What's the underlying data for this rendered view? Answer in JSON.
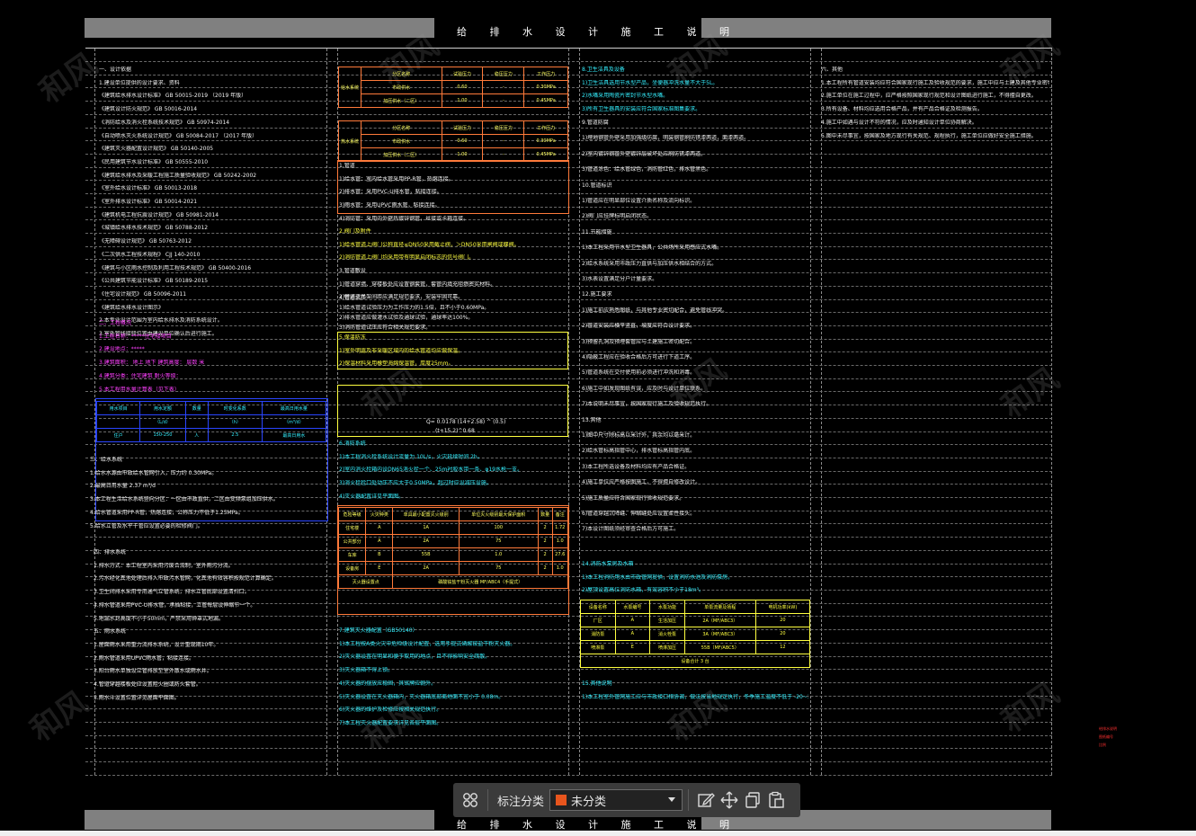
{
  "title": "给 排 水 设 计 施 工 说 明",
  "toolbar": {
    "category_label": "标注分类",
    "category_value": "未分类",
    "swatch_color": "#e8551d",
    "icons": [
      "grid-icon",
      "edit-icon",
      "move-icon",
      "copy-icon",
      "paste-icon"
    ]
  },
  "watermark": "和风",
  "col1": {
    "white_lines_a": [
      "一、设计依据",
      "1.建设单位提供的设计要求、资料",
      "《建筑给水排水设计标准》  GB 50015-2019  （2019 年版）",
      "《建筑设计防火规范》  GB 50016-2014",
      "《消防给水及消火栓系统技术规范》  GB 50974-2014",
      "《自动喷水灭火系统设计规范》  GB 50084-2017  （2017 年版）",
      "《建筑灭火器配置设计规范》  GB 50140-2005",
      "《民用建筑节水设计标准》  GB 50555-2010",
      "《建筑给水排水及采暖工程施工质量验收规范》  GB 50242-2002",
      "《室外给水设计标准》  GB 50013-2018",
      "《室外排水设计标准》  GB 50014-2021",
      "《建筑机电工程抗震设计规范》  GB 50981-2014",
      "《城镇给水排水技术规范》  GB 50788-2012",
      "《无障碍设计规范》  GB 50763-2012",
      "《二次供水工程技术规程》  CJJ 140-2010",
      "《建筑与小区雨水控制及利用工程技术规范》  GB 50400-2016",
      "《公共建筑节能设计标准》  GB 50189-2015",
      "《住宅设计规范》  GB 50096-2011",
      "《建筑给水排水设计图示》",
      "2.本专业设计范围为室内给水排水及消防系统设计。",
      "3.室外管线接驳位置由建设单位确认后进行施工。"
    ],
    "magenta_lines": [
      "二、工程概况",
      "1.工程名称：*****住宅楼项目",
      "2.建设地点：*****",
      "3.建筑面积：  地上  地下  建筑高度：  层数  米",
      "4.建筑分类：住宅建筑  耐火等级：",
      "5.本工程用水量计算表（见下表）"
    ],
    "blue_table": {
      "headers": [
        "用水项目",
        "用水定额",
        "数量",
        "时变化系数",
        "最高日用水量"
      ],
      "units": [
        "",
        "（L/d）",
        "",
        "（h）",
        "（m³/d）"
      ],
      "row": [
        "住户",
        "150-250",
        "人",
        "2.5",
        "最高日用水"
      ]
    },
    "white_lines_b": [
      "三、给水系统",
      "1.给水水源由市政给水管网引入，压力约 0.30MPa。",
      "2.最高日用水量 2.37 m³/d",
      "3.本工程生活给水系统竖向分区：一区由市政直供，二区由变频泵组加压供水。",
      "4.给水管道采用PP-R管，热熔连接，公称压力不低于1.25MPa。",
      "5.给水立管及水平干管应设置必要的检修阀门。"
    ],
    "white_lines_c": [
      "四、排水系统",
      "1.排水方式：本工程室内采用污废合流制，室外雨污分流。",
      "2.污水经化粪池处理后排入市政污水管网，化粪池有效容积按规范计算确定。",
      "3.卫生间排水采用专用通气立管系统，排水立管底部设置清扫口。",
      "4.排水管道采用PVC-U排水管，承插粘接，立管每层设伸缩节一个。",
      "5.地漏水封高度不小于50mm，严禁采用钟罩式地漏。",
      "五、雨水系统",
      "1.屋面雨水采用重力流排水系统，设计重现期10年。",
      "2.雨水管道采用UPVC雨水管，粘接连接。",
      "3.阳台雨水单独设立管排放至室外散水或雨水井。",
      "4.管道穿越楼板处应设置阻火圈或防火套管。",
      "5.雨水斗设置位置详见屋面平面图。"
    ]
  },
  "col2": {
    "table1": {
      "group": "给水系统",
      "headers": [
        "分区名称",
        "试验压力",
        "稳压压力",
        "工作压力"
      ],
      "rows": [
        [
          "市政供水",
          "0.60",
          "-",
          "0.30MPa"
        ],
        [
          "加压供水（二区）",
          "1.00",
          "-",
          "0.45MPa"
        ]
      ]
    },
    "table2": {
      "group": "热水系统",
      "headers": [
        "分区名称",
        "试验压力",
        "稳压压力",
        "工作压力"
      ],
      "rows": [
        [
          "市政供水",
          "0.60",
          "-",
          "0.30MPa"
        ],
        [
          "加压供水（二区）",
          "1.00",
          "-",
          "0.45MPa"
        ]
      ]
    },
    "white_lines_a": [
      "1.管道",
      "1)给水管：室内给水管采用PP-R管，热熔连接。",
      "2)排水管：采用PVC-U排水管，粘接连接。",
      "3)雨水管：采用UPVC雨水管，粘接连接。",
      "4)消防管：采用内外壁热镀锌钢管，丝接或卡箍连接。"
    ],
    "yellow_lines_a": [
      "2.阀门及附件",
      "1)给水管道上阀门公称直径≤DN50采用截止阀，＞DN50采用闸阀或蝶阀。",
      "2)消防管道上阀门均采用带有明显启闭标志的信号阀门。"
    ],
    "white_lines_b": [
      "3.管道敷设",
      "1)管道穿墙、穿楼板处应设置钢套管，套管内填充阻燃密实材料。",
      "2)管道支吊架间距应满足规范要求，安装牢固可靠。"
    ],
    "white_lines_c": [
      "4.管道试压",
      "1)给水管道试验压力为工作压力的1.5倍，且不小于0.60MPa。",
      "2)排水管道应做灌水试验及通球试验，通球率达100%。",
      "3)消防管道试压应符合相关规范要求。"
    ],
    "yellow_box_lines": [
      "5.保温防冻",
      "1)室外明露及非采暖区域内的给水管道均应做保温。",
      "2)保温材料采用橡塑海绵保温管，厚度25mm。"
    ],
    "formula": [
      "Q= 0.0178 (14+2.58) ^ (0.5)",
      "(t+15.2)^0.68"
    ],
    "cyan_lines_a": [
      "6.消防系统",
      "1)本工程消火栓系统设计流量为 10L/s，火灾延续时间 2h。",
      "2)室内消火栓箱内设DN65消火栓一个、25m衬胶水带一条、φ19水枪一支。",
      "3)消火栓栓口处动压不应大于0.50MPa，超过时应设减压设施。",
      "4)灭火器配置详见平面图。"
    ],
    "orange_table": {
      "headers": [
        "危险等级",
        "火灾种类",
        "单具最小配置灭火级别",
        "单位灭火级别最大保护面积",
        "数量",
        "备注"
      ],
      "rows": [
        [
          "住宅楼",
          "A",
          "1A",
          "100",
          "2",
          "1.72"
        ],
        [
          "公共部分",
          "A",
          "2A",
          "75",
          "2",
          "1.0"
        ],
        [
          "车库",
          "B",
          "55B",
          "1.0",
          "2",
          "27.6"
        ],
        [
          "设备房",
          "E",
          "2A",
          "75",
          "2",
          "1.0"
        ]
      ],
      "footer_left": "灭火器设置点",
      "footer_right": "磷酸铵盐干粉灭火器 MF/ABC4（手提式）"
    },
    "cyan_lines_b": [
      "7.建筑灭火器配置（GB50140）",
      "1)本工程按A类火灾中危险级设计配置，选用手提式磷酸铵盐干粉灭火器。",
      "2)灭火器设置在明显和便于取用的地点，且不得影响安全疏散。",
      "3)灭火器箱不得上锁。",
      "4)灭火器的摆放应稳固，其铭牌应朝外。",
      "5)灭火器设置在灭火器箱内，灭火器箱底部离地面不宜小于 0.08m。",
      "6)灭火器的维护及检修应按相关规范执行。",
      "7)本工程灭火器配置要求详见各层平面图。"
    ]
  },
  "col3": {
    "cyan_lines_a": [
      "8.卫生洁具及设备",
      "1)卫生洁具选用节水型产品，坐便器冲洗水量不大于5L。",
      "2)水嘴采用陶瓷片密封节水型水嘴。",
      "3)所有卫生器具的安装应符合国家标准图集要求。"
    ],
    "white_lines_a": [
      "9.管道防腐",
      "1)埋地钢管外壁采用加强级防腐，明装钢管刷防锈漆两道，面漆两道。",
      "2)室内镀锌钢管外壁镀锌层破坏处应刷防锈漆两道。",
      "3)管道涂色：给水管绿色，消防管红色，排水管黑色。",
      "10.管道标识",
      "1)管道应在明显部位设置介质名称及流向标识。",
      "2)阀门应挂牌标明启闭状态。",
      "11.节能措施",
      "1)本工程采用节水型卫生器具，公共场所采用感应式水嘴。",
      "2)给水系统采用市政压力直供与加压供水相结合的方式。",
      "3)水表设置满足分户计量要求。",
      "12.施工要求",
      "1)施工前应熟悉图纸，与其他专业密切配合，避免管线冲突。",
      "2)管道安装应横平竖直，坡度应符合设计要求。",
      "3)预留孔洞及预埋套管应与土建施工密切配合。",
      "4)隐蔽工程应在验收合格后方可进行下道工序。",
      "5)管道系统在交付使用前必须进行冲洗和消毒。",
      "6)施工中如发现图纸有误，应及时与设计单位联系。",
      "7)本说明未尽事宜，按国家现行施工及验收规范执行。",
      "13.其他",
      "1)图中尺寸除标高以米计外，其余均以毫米计。",
      "2)给水管标高指管中心，排水管标高指管内底。",
      "3)本工程所选设备及材料均应有产品合格证。",
      "4)施工单位应严格按图施工，不得擅自修改设计。",
      "5)施工质量应符合国家现行验收规范要求。",
      "6)管道穿越沉降缝、伸缩缝处应设置柔性接头。",
      "7)本设计图纸须经审查合格后方可施工。"
    ],
    "cyan_lines_b": [
      "14.消防水泵房及水箱",
      "1)本工程消防用水由市政管网提供，设置消防水池及消防泵房。",
      "2)屋顶设置高位消防水箱，有效容积不小于18m³。"
    ],
    "yellow_table": {
      "headers": [
        "设备名称",
        "水泵编号",
        "水泵功能",
        "单泵流量及扬程",
        "电机功率(kW)"
      ],
      "rows": [
        [
          "厂区",
          "A",
          "生活加压",
          "2A（MF/ABC3）",
          "20"
        ],
        [
          "消防泵",
          "A",
          "消火栓泵",
          "3A（MF/ABC3）",
          "20"
        ],
        [
          "喷淋泵",
          "E",
          "喷淋加压",
          "55B（MF/ABC5）",
          "12"
        ]
      ],
      "footer": "设备合计  3 台"
    },
    "cyan_lines_c": [
      "15.其他说明",
      "1)本工程室外管网施工应与市政接口相协调，做法按当地规定执行，冬季施工温度不低于 -20~35℃。"
    ]
  },
  "col4": {
    "white_lines": [
      "六、其他",
      "1.本工程所有管道安装均应符合国家现行施工及验收规范的要求，施工中应与土建及其他专业密切配合。",
      "2.施工单位在施工过程中，应严格按照国家现行规范和设计图纸进行施工，不得擅自更改。",
      "3.所有设备、材料均应选用合格产品，并有产品合格证及检测报告。",
      "4.施工中如遇与设计不符的情况，应及时通知设计单位协商解决。",
      "5.图中未尽事宜，按国家及地方现行有关规范、规程执行，施工单位应做好安全施工措施。"
    ]
  },
  "right_marks": [
    "给排水说明",
    "图纸编号",
    "比例"
  ]
}
